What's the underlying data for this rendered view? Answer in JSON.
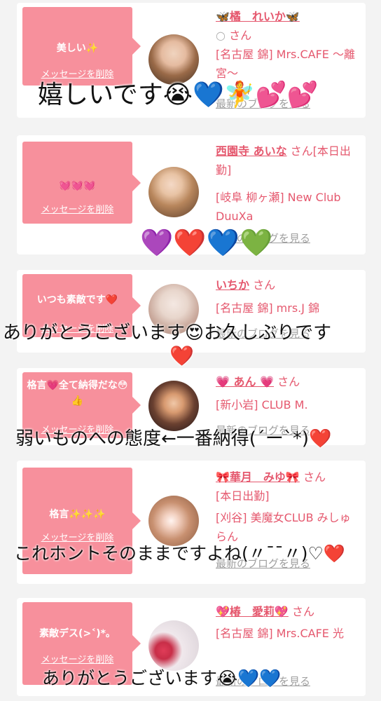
{
  "delete_label": "メッセージを削除",
  "blog_label": "最新のブログを見る",
  "cards": [
    {
      "message": "美しい✨",
      "name": "🦋橘　れいか🦋",
      "name_prefix": "○",
      "name_suffix": "さん",
      "shop": "[名古屋 錦] Mrs.CAFE 〜離宮〜",
      "overlay": "嬉しいです😭💙🧚💕💕"
    },
    {
      "message": "💓💓💓",
      "name": "西園寺 あいな",
      "name_suffix": "さん[本日出勤]",
      "shop": "[岐阜 柳ヶ瀬] New Club DuuXa",
      "overlay": "💜❤️💙💚"
    },
    {
      "message": "いつも素敵です❤️",
      "name": "いちか",
      "name_suffix": "さん",
      "shop": "[名古屋 錦] mrs.J 錦",
      "overlay": "ありがとうございます😍お久しぶりです",
      "overlay2": "❤️"
    },
    {
      "message": "格言💗全て納得だな😳👍",
      "name": "💗 あん 💗",
      "name_suffix": "さん",
      "shop": "[新小岩] CLUB M.",
      "overlay": "弱いものへの態度←一番納得(´ー`*)❤️"
    },
    {
      "message": "格言✨✨✨",
      "name": "🎀華月　みゆ🎀",
      "name_suffix": "さん",
      "shop_status": "[本日出勤]",
      "shop": "[刈谷] 美魔女CLUB みしゅらん",
      "overlay": "これホントそのままですよね(〃¯¯〃)♡❤️"
    },
    {
      "message": "素敵デス(>˂)*。",
      "name": "💖椿　愛莉💖",
      "name_suffix": "さん",
      "shop": "[名古屋 錦] Mrs.CAFE 光",
      "overlay": "ありがとうございます😭💙💙"
    }
  ],
  "colors": {
    "bubble": "#f7909c",
    "name": "#e5586e",
    "blog": "#a0a0a0",
    "background": "#f3f3f3"
  }
}
